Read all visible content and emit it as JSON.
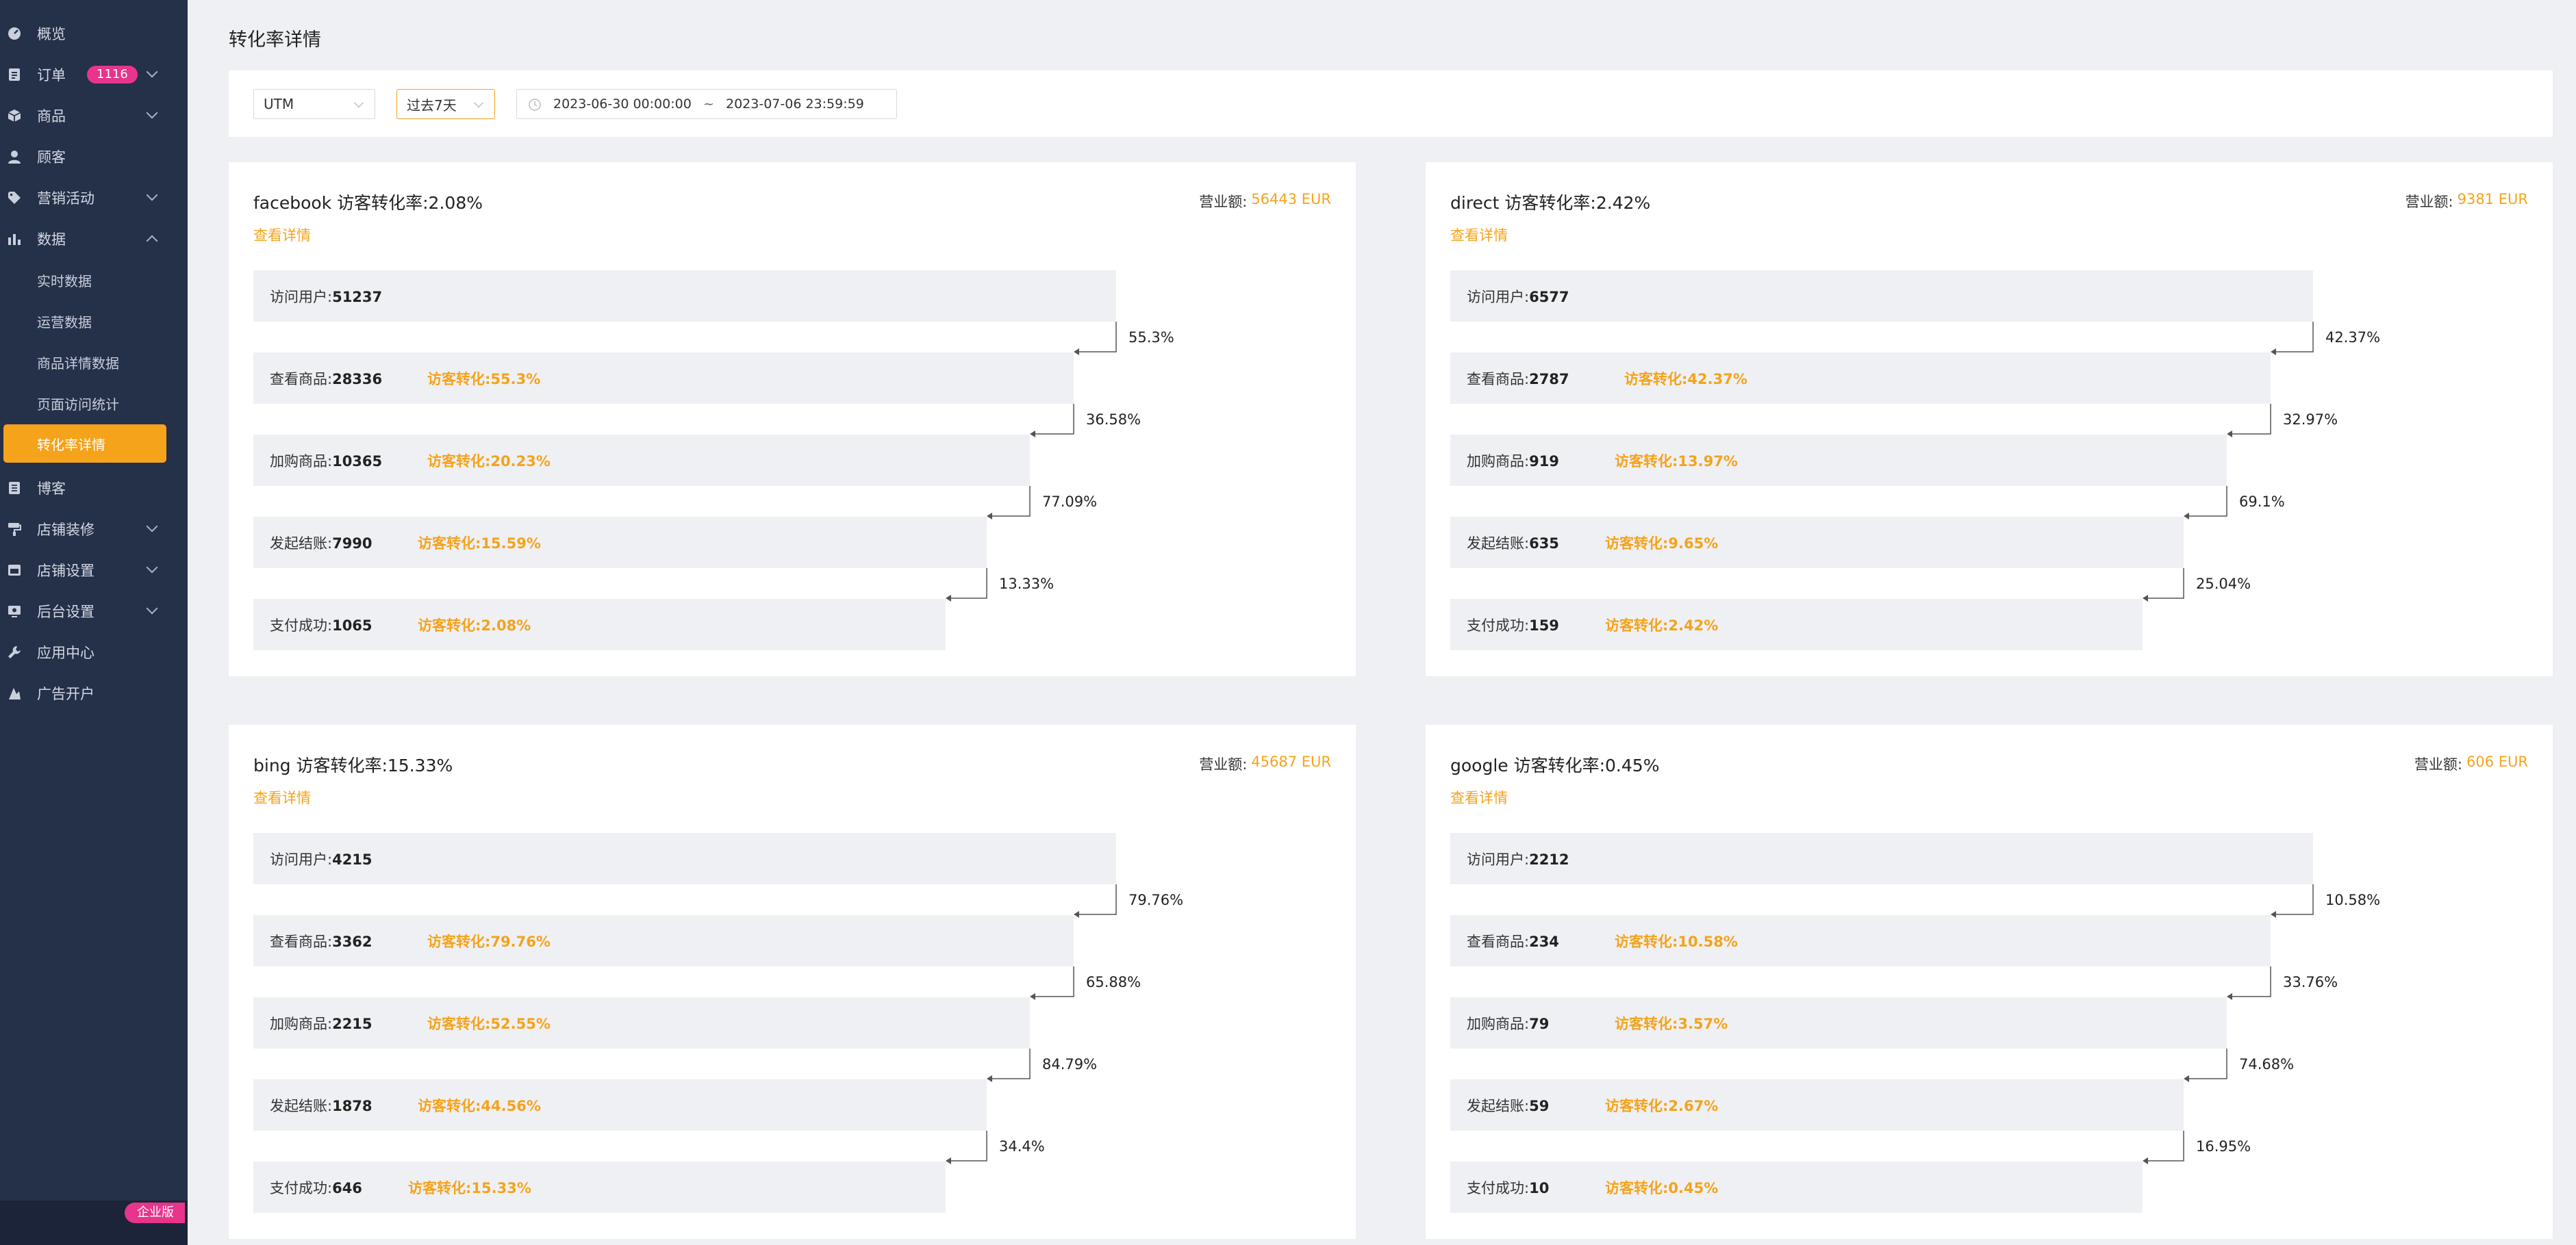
{
  "sidebar": {
    "items": [
      {
        "label": "概览",
        "icon": "dashboard-icon"
      },
      {
        "label": "订单",
        "icon": "order-icon",
        "badge": "1116"
      },
      {
        "label": "商品",
        "icon": "box-icon"
      },
      {
        "label": "顾客",
        "icon": "user-icon"
      },
      {
        "label": "营销活动",
        "icon": "tag-icon"
      },
      {
        "label": "数据",
        "icon": "bar-chart-icon"
      },
      {
        "label": "博客",
        "icon": "blog-icon"
      },
      {
        "label": "店铺装修",
        "icon": "paint-roller-icon"
      },
      {
        "label": "店铺设置",
        "icon": "store-icon"
      },
      {
        "label": "后台设置",
        "icon": "monitor-icon"
      },
      {
        "label": "应用中心",
        "icon": "wrench-icon"
      },
      {
        "label": "广告开户",
        "icon": "ads-icon"
      }
    ],
    "data_sub_items": [
      "实时数据",
      "运营数据",
      "商品详情数据",
      "页面访问统计",
      "转化率详情"
    ],
    "edition": "企业版"
  },
  "page": {
    "title": "转化率详情"
  },
  "filters": {
    "source": "UTM",
    "period": "过去7天",
    "start": "2023-06-30 00:00:00",
    "separator": "~",
    "end": "2023-07-06 23:59:59"
  },
  "labels": {
    "revenue": "营业额:",
    "detail": "查看详情",
    "conv_prefix": "访客转化:",
    "stages": [
      "访问用户:",
      "查看商品:",
      "加购商品:",
      "发起结账:",
      "支付成功:"
    ]
  },
  "cards": [
    {
      "title": "facebook 访客转化率:2.08%",
      "revenue": "56443 EUR",
      "counts": [
        "51237",
        "28336",
        "10365",
        "7990",
        "1065"
      ],
      "conversions": [
        "",
        "55.3%",
        "20.23%",
        "15.59%",
        "2.08%"
      ],
      "step_rates": [
        "55.3%",
        "36.58%",
        "77.09%",
        "13.33%"
      ]
    },
    {
      "title": "direct 访客转化率:2.42%",
      "revenue": "9381 EUR",
      "counts": [
        "6577",
        "2787",
        "919",
        "635",
        "159"
      ],
      "conversions": [
        "",
        "42.37%",
        "13.97%",
        "9.65%",
        "2.42%"
      ],
      "step_rates": [
        "42.37%",
        "32.97%",
        "69.1%",
        "25.04%"
      ]
    },
    {
      "title": "bing 访客转化率:15.33%",
      "revenue": "45687 EUR",
      "counts": [
        "4215",
        "3362",
        "2215",
        "1878",
        "646"
      ],
      "conversions": [
        "",
        "79.76%",
        "52.55%",
        "44.56%",
        "15.33%"
      ],
      "step_rates": [
        "79.76%",
        "65.88%",
        "84.79%",
        "34.4%"
      ]
    },
    {
      "title": "google 访客转化率:0.45%",
      "revenue": "606 EUR",
      "counts": [
        "2212",
        "234",
        "79",
        "59",
        "10"
      ],
      "conversions": [
        "",
        "10.58%",
        "3.57%",
        "2.67%",
        "0.45%"
      ],
      "step_rates": [
        "10.58%",
        "33.76%",
        "74.68%",
        "16.95%"
      ]
    }
  ]
}
